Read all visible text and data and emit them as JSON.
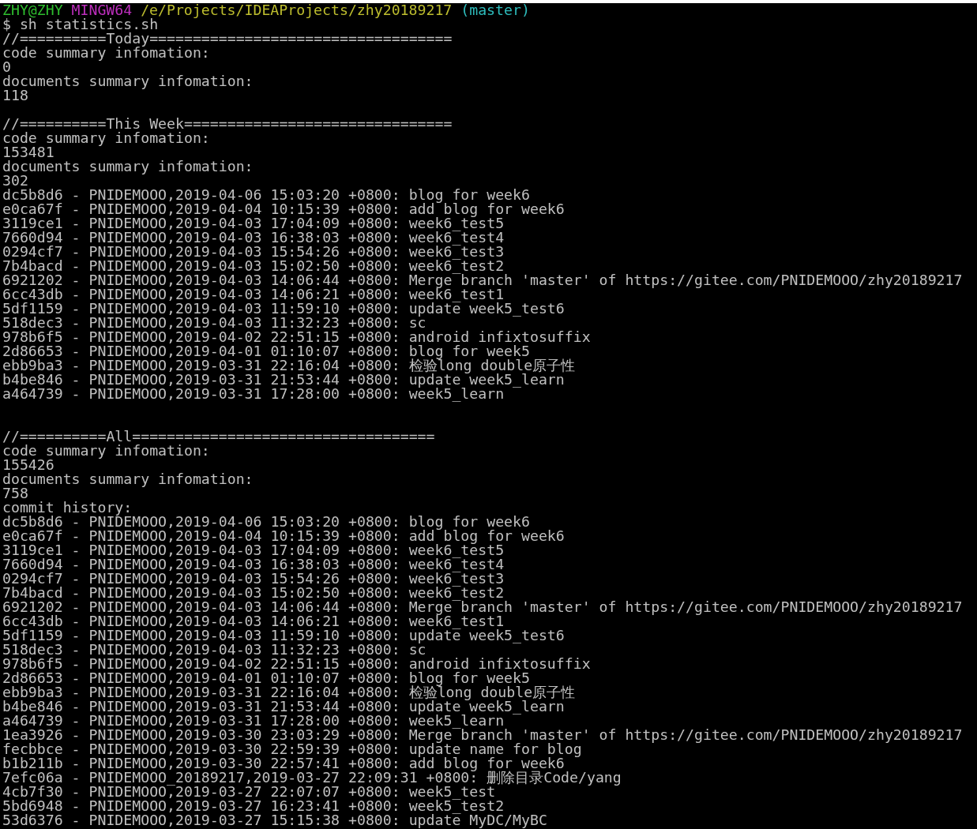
{
  "prompt": {
    "segments": [
      {
        "text": "ZHY@ZHY",
        "color": "#2ebd2e"
      },
      {
        "text": "MINGW64",
        "color": "#bd2ebd"
      },
      {
        "text": "/e/Projects/IDEAProjects/zhy20189217",
        "color": "#bdbd2e"
      },
      {
        "text": "(master)",
        "color": "#2ebdbd"
      }
    ],
    "command": "$ sh statistics.sh"
  },
  "lines": [
    {
      "kind": "text",
      "text": "//==========Today==================================="
    },
    {
      "kind": "text",
      "text": "code summary infomation:"
    },
    {
      "kind": "text",
      "text": "0"
    },
    {
      "kind": "text",
      "text": "documents summary infomation:"
    },
    {
      "kind": "text",
      "text": "118"
    },
    {
      "kind": "blank"
    },
    {
      "kind": "text",
      "text": "//==========This Week==============================="
    },
    {
      "kind": "text",
      "text": "code summary infomation:"
    },
    {
      "kind": "text",
      "text": "153481"
    },
    {
      "kind": "text",
      "text": "documents summary infomation:"
    },
    {
      "kind": "text",
      "text": "302"
    },
    {
      "kind": "text",
      "text": "dc5b8d6 - PNIDEMOOO,2019-04-06 15:03:20 +0800: blog for week6"
    },
    {
      "kind": "text",
      "text": "e0ca67f - PNIDEMOOO,2019-04-04 10:15:39 +0800: add blog for week6"
    },
    {
      "kind": "text",
      "text": "3119ce1 - PNIDEMOOO,2019-04-03 17:04:09 +0800: week6_test5"
    },
    {
      "kind": "text",
      "text": "7660d94 - PNIDEMOOO,2019-04-03 16:38:03 +0800: week6_test4"
    },
    {
      "kind": "text",
      "text": "0294cf7 - PNIDEMOOO,2019-04-03 15:54:26 +0800: week6_test3"
    },
    {
      "kind": "text",
      "text": "7b4bacd - PNIDEMOOO,2019-04-03 15:02:50 +0800: week6_test2"
    },
    {
      "kind": "text",
      "text": "6921202 - PNIDEMOOO,2019-04-03 14:06:44 +0800: Merge branch 'master' of https://gitee.com/PNIDEMOOO/zhy20189217"
    },
    {
      "kind": "text",
      "text": "6cc43db - PNIDEMOOO,2019-04-03 14:06:21 +0800: week6_test1"
    },
    {
      "kind": "text",
      "text": "5df1159 - PNIDEMOOO,2019-04-03 11:59:10 +0800: update week5_test6"
    },
    {
      "kind": "text",
      "text": "518dec3 - PNIDEMOOO,2019-04-03 11:32:23 +0800: sc"
    },
    {
      "kind": "text",
      "text": "978b6f5 - PNIDEMOOO,2019-04-02 22:51:15 +0800: android infixtosuffix"
    },
    {
      "kind": "text",
      "text": "2d86653 - PNIDEMOOO,2019-04-01 01:10:07 +0800: blog for week5"
    },
    {
      "kind": "text",
      "text": "ebb9ba3 - PNIDEMOOO,2019-03-31 22:16:04 +0800: 检验long double原子性"
    },
    {
      "kind": "text",
      "text": "b4be846 - PNIDEMOOO,2019-03-31 21:53:44 +0800: update week5_learn"
    },
    {
      "kind": "text",
      "text": "a464739 - PNIDEMOOO,2019-03-31 17:28:00 +0800: week5_learn"
    },
    {
      "kind": "blank"
    },
    {
      "kind": "blank"
    },
    {
      "kind": "text",
      "text": "//==========All==================================="
    },
    {
      "kind": "text",
      "text": "code summary infomation:"
    },
    {
      "kind": "text",
      "text": "155426"
    },
    {
      "kind": "text",
      "text": "documents summary infomation:"
    },
    {
      "kind": "text",
      "text": "758"
    },
    {
      "kind": "text",
      "text": "commit history:"
    },
    {
      "kind": "text",
      "text": "dc5b8d6 - PNIDEMOOO,2019-04-06 15:03:20 +0800: blog for week6"
    },
    {
      "kind": "text",
      "text": "e0ca67f - PNIDEMOOO,2019-04-04 10:15:39 +0800: add blog for week6"
    },
    {
      "kind": "text",
      "text": "3119ce1 - PNIDEMOOO,2019-04-03 17:04:09 +0800: week6_test5"
    },
    {
      "kind": "text",
      "text": "7660d94 - PNIDEMOOO,2019-04-03 16:38:03 +0800: week6_test4"
    },
    {
      "kind": "text",
      "text": "0294cf7 - PNIDEMOOO,2019-04-03 15:54:26 +0800: week6_test3"
    },
    {
      "kind": "text",
      "text": "7b4bacd - PNIDEMOOO,2019-04-03 15:02:50 +0800: week6_test2"
    },
    {
      "kind": "text",
      "text": "6921202 - PNIDEMOOO,2019-04-03 14:06:44 +0800: Merge branch 'master' of https://gitee.com/PNIDEMOOO/zhy20189217"
    },
    {
      "kind": "text",
      "text": "6cc43db - PNIDEMOOO,2019-04-03 14:06:21 +0800: week6_test1"
    },
    {
      "kind": "text",
      "text": "5df1159 - PNIDEMOOO,2019-04-03 11:59:10 +0800: update week5_test6"
    },
    {
      "kind": "text",
      "text": "518dec3 - PNIDEMOOO,2019-04-03 11:32:23 +0800: sc"
    },
    {
      "kind": "text",
      "text": "978b6f5 - PNIDEMOOO,2019-04-02 22:51:15 +0800: android infixtosuffix"
    },
    {
      "kind": "text",
      "text": "2d86653 - PNIDEMOOO,2019-04-01 01:10:07 +0800: blog for week5"
    },
    {
      "kind": "text",
      "text": "ebb9ba3 - PNIDEMOOO,2019-03-31 22:16:04 +0800: 检验long double原子性"
    },
    {
      "kind": "text",
      "text": "b4be846 - PNIDEMOOO,2019-03-31 21:53:44 +0800: update week5_learn"
    },
    {
      "kind": "text",
      "text": "a464739 - PNIDEMOOO,2019-03-31 17:28:00 +0800: week5_learn"
    },
    {
      "kind": "text",
      "text": "1ea3926 - PNIDEMOOO,2019-03-30 23:03:29 +0800: Merge branch 'master' of https://gitee.com/PNIDEMOOO/zhy20189217"
    },
    {
      "kind": "text",
      "text": "fecbbce - PNIDEMOOO,2019-03-30 22:59:39 +0800: update name for blog"
    },
    {
      "kind": "text",
      "text": "b1b211b - PNIDEMOOO,2019-03-30 22:57:41 +0800: add blog for week6"
    },
    {
      "kind": "text",
      "text": "7efc06a - PNIDEMOOO_20189217,2019-03-27 22:09:31 +0800: 删除目录Code/yang"
    },
    {
      "kind": "text",
      "text": "4cb7f30 - PNIDEMOOO,2019-03-27 22:07:07 +0800: week5_test"
    },
    {
      "kind": "text",
      "text": "5bd6948 - PNIDEMOOO,2019-03-27 16:23:41 +0800: week5_test2"
    },
    {
      "kind": "text",
      "text": "53d6376 - PNIDEMOOO,2019-03-27 15:15:38 +0800: update MyDC/MyBC"
    }
  ]
}
